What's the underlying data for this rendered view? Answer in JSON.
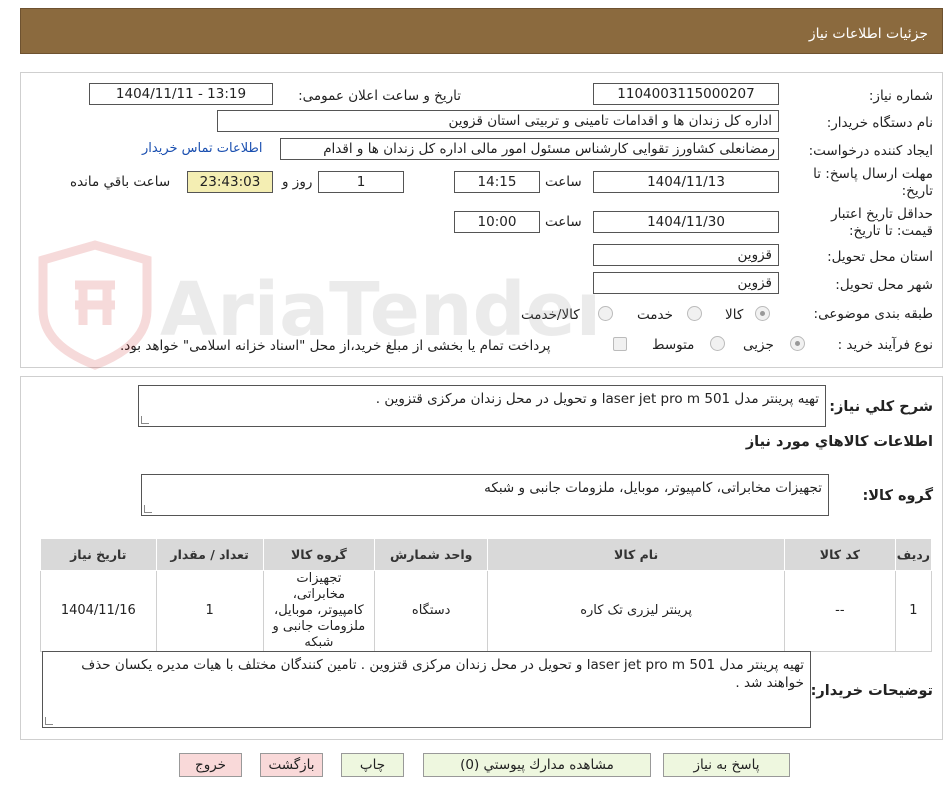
{
  "header": {
    "title": "جزئیات اطلاعات نیاز"
  },
  "details": {
    "need_number_label": "شماره نیاز:",
    "need_number": "1104003115000207",
    "announce_label": "تاریخ و ساعت اعلان عمومی:",
    "announce_value": "1404/11/11 - 13:19",
    "buyer_org_label": "نام دستگاه خریدار:",
    "buyer_org": "اداره کل زندان ها و اقدامات تامینی و تربیتی استان قزوین",
    "requester_label": "ایجاد کننده درخواست:",
    "requester": "رمضانعلی کشاورز تقوایی کارشناس مسئول امور مالی  اداره کل زندان ها و اقدام",
    "contact_link": "اطلاعات تماس خریدار",
    "deadline_label_1": "مهلت ارسال پاسخ: تا",
    "deadline_label_2": "تاریخ:",
    "deadline_date": "1404/11/13",
    "time_word": "ساعت",
    "deadline_time": "14:15",
    "days_value": "1",
    "days_word": "روز و",
    "remaining_time": "23:43:03",
    "remaining_word": "ساعت باقي مانده",
    "validity_label_1": "حداقل تاریخ اعتبار",
    "validity_label_2": "قیمت: تا تاریخ:",
    "validity_date": "1404/11/30",
    "validity_time": "10:00",
    "province_label": "استان محل تحویل:",
    "province": "قزوین",
    "city_label": "شهر محل تحویل:",
    "city": "قزوین",
    "category_label": "طبقه بندی موضوعی:",
    "category_options": [
      "کالا",
      "خدمت",
      "کالا/خدمت"
    ],
    "process_label": "نوع فرآیند خرید :",
    "process_options": [
      "جزیی",
      "متوسط"
    ],
    "payment_note": "پرداخت تمام یا بخشی از مبلغ خرید،از محل \"اسناد خزانه اسلامی\" خواهد بود."
  },
  "summary": {
    "general_desc_label": "شرح کلي نياز:",
    "general_desc": "تهیه پرینتر مدل laser jet pro m 501  و تحویل در محل زندان مرکزی قتزوین .",
    "goods_info_title": "اطلاعات کالاهاي مورد نياز",
    "goods_group_label": "گروه کالا:",
    "goods_group": "تجهیزات مخابراتی، کامپیوتر، موبایل، ملزومات جانبی و شبکه"
  },
  "table": {
    "headers": [
      "رديف",
      "کد کالا",
      "نام کالا",
      "واحد شمارش",
      "گروه کالا",
      "تعداد / مقدار",
      "تاريخ نياز"
    ],
    "rows": [
      [
        "1",
        "--",
        "پرینتر لیزری تک کاره",
        "دستگاه",
        "تجهیزات مخابراتی، کامپیوتر، موبایل، ملزومات جانبی و شبکه",
        "1",
        "1404/11/16"
      ]
    ]
  },
  "buyer_notes": {
    "label": "توضيحات خريدار:",
    "text": "تهیه پرینتر مدل laser jet pro m 501  و تحویل در محل زندان مرکزی قتزوین . تامین کنندگان مختلف با هیات مدیره یکسان حذف خواهند شد ."
  },
  "buttons": {
    "reply": "پاسخ به نياز",
    "attachments": "مشاهده مدارك پيوستي (0)",
    "print": "چاپ",
    "back": "بازگشت",
    "exit": "خروج"
  },
  "watermark": {
    "text": "AriaTender.neT"
  },
  "colors": {
    "header_bg": "#8b6a3e",
    "accent_link": "#1a4fb0",
    "remaining_bg": "#f4eeb3"
  }
}
